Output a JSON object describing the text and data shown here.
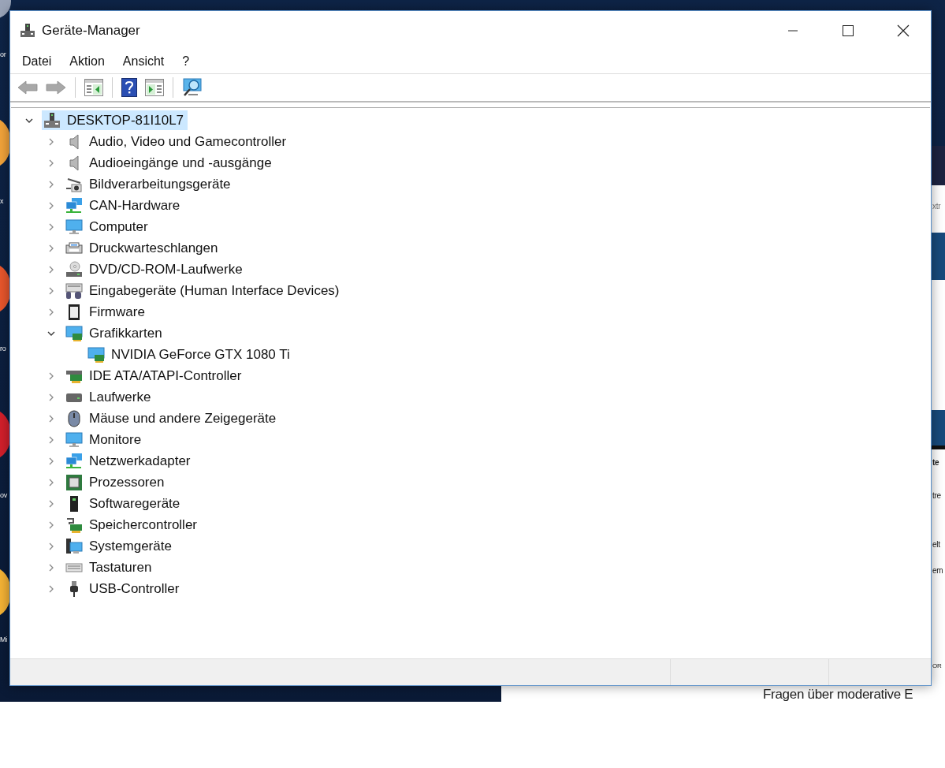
{
  "background": {
    "desktop_labels": [
      {
        "text": "or"
      },
      {
        "text": "x"
      },
      {
        "text": "ro"
      },
      {
        "text": "ov"
      },
      {
        "text": "Mi"
      }
    ],
    "browser_texts": [
      {
        "text": "xtr",
        "kind": "field"
      },
      {
        "text": "te",
        "kind": "heading"
      },
      {
        "text": "tre",
        "kind": "body"
      },
      {
        "text": "elt",
        "kind": "body"
      },
      {
        "text": "em",
        "kind": "body"
      },
      {
        "text": "OR",
        "kind": "small"
      },
      {
        "text": "Fragen über moderative E",
        "kind": "body"
      }
    ]
  },
  "window": {
    "title": "Geräte-Manager"
  },
  "menu": [
    "Datei",
    "Aktion",
    "Ansicht",
    "?"
  ],
  "toolbar": [
    {
      "kind": "back",
      "disabled": true
    },
    {
      "kind": "forward",
      "disabled": true
    },
    {
      "kind": "separator"
    },
    {
      "kind": "console"
    },
    {
      "kind": "separator"
    },
    {
      "kind": "help"
    },
    {
      "kind": "action"
    },
    {
      "kind": "separator"
    },
    {
      "kind": "scan"
    }
  ],
  "tree": {
    "label": "DESKTOP-81I10L7",
    "kind": "computer-root",
    "expanded": true,
    "selected": true,
    "children": [
      {
        "label": "Audio, Video und Gamecontroller",
        "kind": "speaker",
        "expanded": false,
        "selected": false
      },
      {
        "label": "Audioeingänge und -ausgänge",
        "kind": "speaker",
        "expanded": false,
        "selected": false
      },
      {
        "label": "Bildverarbeitungsgeräte",
        "kind": "camera",
        "expanded": false,
        "selected": false
      },
      {
        "label": "CAN-Hardware",
        "kind": "network",
        "expanded": false,
        "selected": false
      },
      {
        "label": "Computer",
        "kind": "monitor",
        "expanded": false,
        "selected": false
      },
      {
        "label": "Druckwarteschlangen",
        "kind": "printer",
        "expanded": false,
        "selected": false
      },
      {
        "label": "DVD/CD-ROM-Laufwerke",
        "kind": "disc",
        "expanded": false,
        "selected": false
      },
      {
        "label": "Eingabegeräte (Human Interface Devices)",
        "kind": "hid",
        "expanded": false,
        "selected": false
      },
      {
        "label": "Firmware",
        "kind": "chip",
        "expanded": false,
        "selected": false
      },
      {
        "label": "Grafikkarten",
        "kind": "display-card",
        "expanded": true,
        "selected": false,
        "children": [
          {
            "label": "NVIDIA GeForce GTX 1080 Ti",
            "kind": "display-card",
            "selected": false
          }
        ]
      },
      {
        "label": "IDE ATA/ATAPI-Controller",
        "kind": "card",
        "expanded": false,
        "selected": false
      },
      {
        "label": "Laufwerke",
        "kind": "drive",
        "expanded": false,
        "selected": false
      },
      {
        "label": "Mäuse und andere Zeigegeräte",
        "kind": "mouse",
        "expanded": false,
        "selected": false
      },
      {
        "label": "Monitore",
        "kind": "monitor",
        "expanded": false,
        "selected": false
      },
      {
        "label": "Netzwerkadapter",
        "kind": "network",
        "expanded": false,
        "selected": false
      },
      {
        "label": "Prozessoren",
        "kind": "cpu",
        "expanded": false,
        "selected": false
      },
      {
        "label": "Softwaregeräte",
        "kind": "software",
        "expanded": false,
        "selected": false
      },
      {
        "label": "Speichercontroller",
        "kind": "storage",
        "expanded": false,
        "selected": false
      },
      {
        "label": "Systemgeräte",
        "kind": "system",
        "expanded": false,
        "selected": false
      },
      {
        "label": "Tastaturen",
        "kind": "keyboard",
        "expanded": false,
        "selected": false
      },
      {
        "label": "USB-Controller",
        "kind": "usb",
        "expanded": false,
        "selected": false
      }
    ]
  }
}
